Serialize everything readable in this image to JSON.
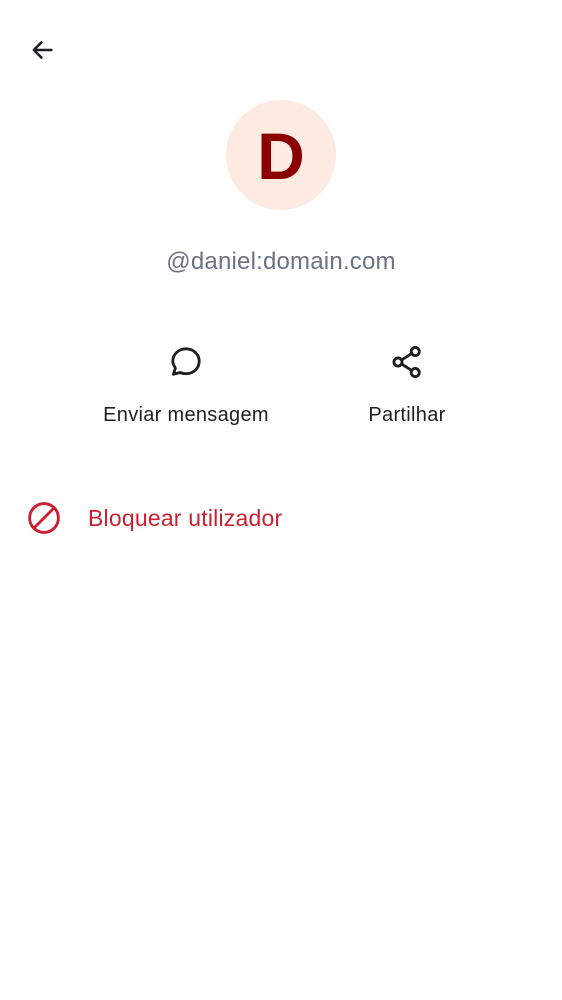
{
  "colors": {
    "avatar_bg": "#fdebe1",
    "avatar_fg": "#8b0000",
    "danger": "#cc1f2f",
    "icon": "#1f1f22",
    "secondary_text": "#6b7280"
  },
  "header": {
    "back_icon": "arrow-back-icon"
  },
  "profile": {
    "avatar_letter": "D",
    "user_id": "@daniel:domain.com"
  },
  "actions": [
    {
      "icon": "chat-bubble-icon",
      "label": "Enviar mensagem"
    },
    {
      "icon": "share-icon",
      "label": "Partilhar"
    }
  ],
  "block": {
    "icon": "block-icon",
    "label": "Bloquear utilizador"
  }
}
